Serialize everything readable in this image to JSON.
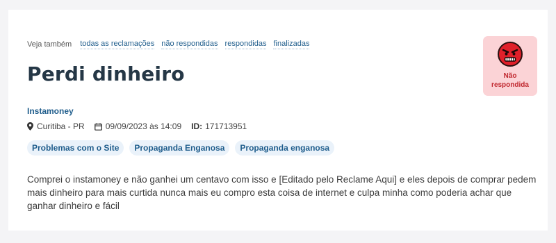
{
  "see_also": {
    "lead": "Veja também",
    "links": [
      "todas as reclamações",
      "não respondidas",
      "respondidas",
      "finalizadas"
    ]
  },
  "complaint": {
    "title": "Perdi dinheiro",
    "company": "Instamoney",
    "location": "Curitiba - PR",
    "datetime": "09/09/2023 às 14:09",
    "id_label": "ID:",
    "id_value": "171713951",
    "tags": [
      "Problemas com o Site",
      "Propaganda Enganosa",
      "Propaganda enganosa"
    ],
    "description": "Comprei o instamoney e não ganhei um centavo com isso e [Editado pelo Reclame Aqui] e eles depois de comprar pedem mais dinheiro para mais curtida nunca mais eu compro esta coisa de internet e culpa minha como poderia achar que ganhar dinheiro e fácil"
  },
  "status": {
    "label_line1": "Não",
    "label_line2": "respondida",
    "icon": "angry-face-icon",
    "color": "#c0282f",
    "background": "#fbd3d6"
  },
  "colors": {
    "link": "#1f5d8c",
    "title": "#253746",
    "tag_bg": "#eaf2fa"
  }
}
